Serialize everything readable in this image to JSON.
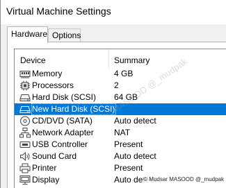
{
  "window": {
    "title": "Virtual Machine Settings"
  },
  "tabs": [
    {
      "label": "Hardware",
      "active": true
    },
    {
      "label": "Options",
      "active": false
    }
  ],
  "table": {
    "columns": [
      "Device",
      "Summary"
    ],
    "rows": [
      {
        "device": "Memory",
        "summary": "4 GB",
        "icon": "memory-icon"
      },
      {
        "device": "Processors",
        "summary": "2",
        "icon": "processor-icon"
      },
      {
        "device": "Hard Disk (SCSI)",
        "summary": "64 GB",
        "icon": "hard-disk-icon"
      },
      {
        "device": "New Hard Disk (SCSI)",
        "summary": "",
        "icon": "hard-disk-icon",
        "selected": true
      },
      {
        "device": "CD/DVD (SATA)",
        "summary": "Auto detect",
        "icon": "cd-dvd-icon"
      },
      {
        "device": "Network Adapter",
        "summary": "NAT",
        "icon": "network-adapter-icon"
      },
      {
        "device": "USB Controller",
        "summary": "Present",
        "icon": "usb-icon"
      },
      {
        "device": "Sound Card",
        "summary": "Auto detect",
        "icon": "speaker-icon"
      },
      {
        "device": "Printer",
        "summary": "Present",
        "icon": "printer-icon"
      },
      {
        "device": "Display",
        "summary": "Auto detect",
        "icon": "display-icon"
      }
    ]
  },
  "watermark": "MASOOD @_mudpak",
  "credit": "© Mudsar MASOOD @_mudpak",
  "colors": {
    "selection": "#0078d7",
    "background": "#f0f0f0"
  }
}
